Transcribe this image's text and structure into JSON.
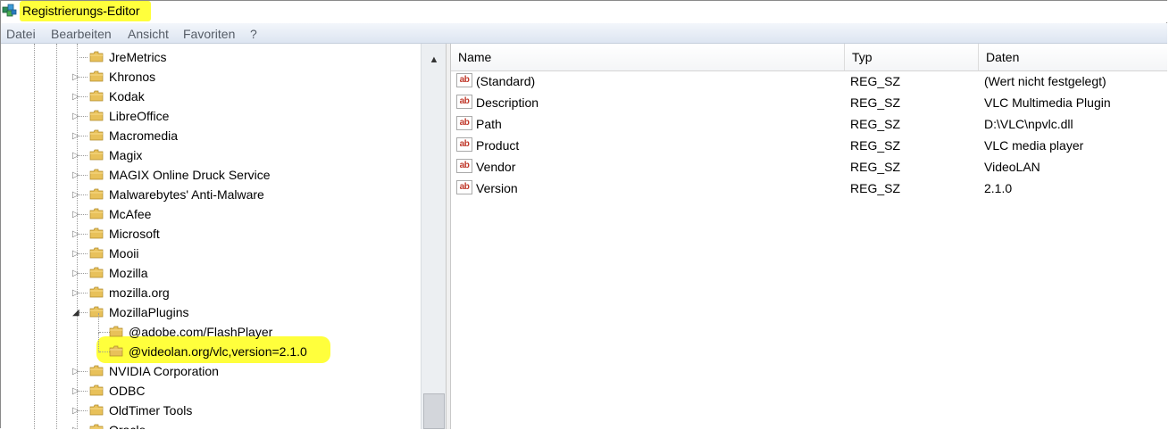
{
  "window": {
    "title": "Registrierungs-Editor"
  },
  "menu": [
    "Datei",
    "Bearbeiten",
    "Ansicht",
    "Favoriten",
    "?"
  ],
  "tree": {
    "nodes": [
      {
        "label": "JreMetrics",
        "depth": 1,
        "state": "leaf"
      },
      {
        "label": "Khronos",
        "depth": 1,
        "state": "collapsed"
      },
      {
        "label": "Kodak",
        "depth": 1,
        "state": "collapsed"
      },
      {
        "label": "LibreOffice",
        "depth": 1,
        "state": "collapsed"
      },
      {
        "label": "Macromedia",
        "depth": 1,
        "state": "collapsed"
      },
      {
        "label": "Magix",
        "depth": 1,
        "state": "collapsed"
      },
      {
        "label": "MAGIX Online Druck Service",
        "depth": 1,
        "state": "collapsed"
      },
      {
        "label": "Malwarebytes' Anti-Malware",
        "depth": 1,
        "state": "collapsed"
      },
      {
        "label": "McAfee",
        "depth": 1,
        "state": "collapsed"
      },
      {
        "label": "Microsoft",
        "depth": 1,
        "state": "collapsed"
      },
      {
        "label": "Mooii",
        "depth": 1,
        "state": "collapsed"
      },
      {
        "label": "Mozilla",
        "depth": 1,
        "state": "collapsed"
      },
      {
        "label": "mozilla.org",
        "depth": 1,
        "state": "collapsed"
      },
      {
        "label": "MozillaPlugins",
        "depth": 1,
        "state": "expanded"
      },
      {
        "label": "@adobe.com/FlashPlayer",
        "depth": 2,
        "state": "leaf"
      },
      {
        "label": "@videolan.org/vlc,version=2.1.0",
        "depth": 2,
        "state": "leaf",
        "selected": true
      },
      {
        "label": "NVIDIA Corporation",
        "depth": 1,
        "state": "collapsed"
      },
      {
        "label": "ODBC",
        "depth": 1,
        "state": "collapsed"
      },
      {
        "label": "OldTimer Tools",
        "depth": 1,
        "state": "collapsed"
      },
      {
        "label": "Oracle",
        "depth": 1,
        "state": "collapsed"
      }
    ]
  },
  "list": {
    "columns": [
      "Name",
      "Typ",
      "Daten"
    ],
    "rows": [
      {
        "name": "(Standard)",
        "type": "REG_SZ",
        "data": "(Wert nicht festgelegt)"
      },
      {
        "name": "Description",
        "type": "REG_SZ",
        "data": "VLC Multimedia Plugin"
      },
      {
        "name": "Path",
        "type": "REG_SZ",
        "data": "D:\\VLC\\npvlc.dll"
      },
      {
        "name": "Product",
        "type": "REG_SZ",
        "data": "VLC media player"
      },
      {
        "name": "Vendor",
        "type": "REG_SZ",
        "data": "VideoLAN"
      },
      {
        "name": "Version",
        "type": "REG_SZ",
        "data": "2.1.0"
      }
    ],
    "value_icon": "string-value-icon",
    "value_icon_text": "ab"
  },
  "colors": {
    "highlight": "#ffff3c",
    "folder": "#e8c15a"
  }
}
